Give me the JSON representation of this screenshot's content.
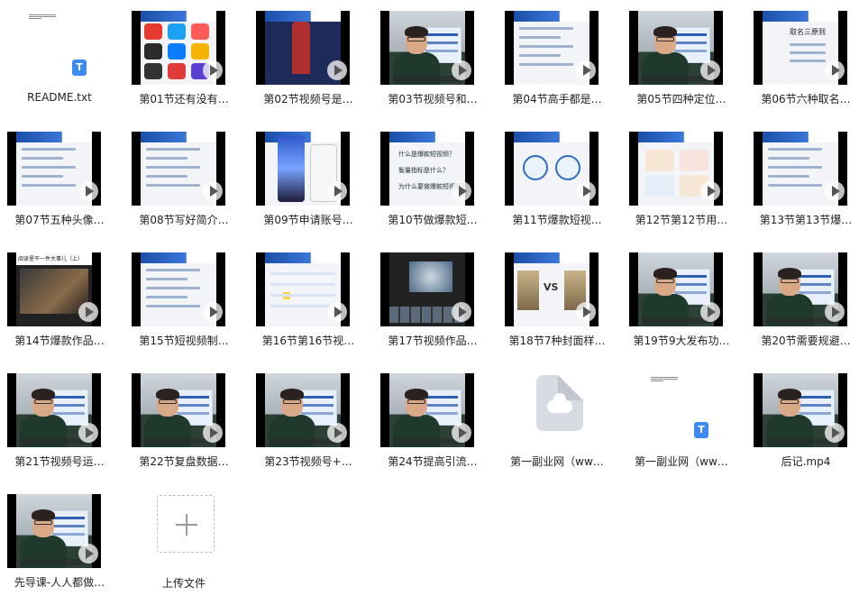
{
  "files": [
    {
      "name": "README.txt",
      "kind": "txt"
    },
    {
      "name": "第01节还有没有…",
      "kind": "video",
      "style": "apps"
    },
    {
      "name": "第02节视频号是…",
      "kind": "video",
      "style": "stage"
    },
    {
      "name": "第03节视频号和…",
      "kind": "video",
      "style": "person"
    },
    {
      "name": "第04节高手都是…",
      "kind": "video",
      "style": "list"
    },
    {
      "name": "第05节四种定位…",
      "kind": "video",
      "style": "person"
    },
    {
      "name": "第06节六种取名…",
      "kind": "video",
      "style": "slide",
      "slide_text": "取名三原则"
    },
    {
      "name": "第07节五种头像…",
      "kind": "video",
      "style": "slide"
    },
    {
      "name": "第08节写好简介…",
      "kind": "video",
      "style": "list"
    },
    {
      "name": "第09节申请账号…",
      "kind": "video",
      "style": "phone"
    },
    {
      "name": "第10节做爆款短…",
      "kind": "video",
      "style": "questions",
      "slide_lines": [
        "什么是爆款短视频？",
        "衡量指标是什么？",
        "为什么要做爆款短视频？"
      ]
    },
    {
      "name": "第11节爆款短视…",
      "kind": "video",
      "style": "circles"
    },
    {
      "name": "第12节第12节用…",
      "kind": "video",
      "style": "cards"
    },
    {
      "name": "第13节第13节爆…",
      "kind": "video",
      "style": "list"
    },
    {
      "name": "第14节爆款作品…",
      "kind": "video",
      "style": "dark",
      "slide_text": "阅读里干一件大事儿（上）"
    },
    {
      "name": "第15节短视频制…",
      "kind": "video",
      "style": "slide"
    },
    {
      "name": "第16节第16节视…",
      "kind": "video",
      "style": "timeline"
    },
    {
      "name": "第17节视频作品…",
      "kind": "video",
      "style": "editor"
    },
    {
      "name": "第18节7种封面样…",
      "kind": "video",
      "style": "vs",
      "slide_text": "VS"
    },
    {
      "name": "第19节9大发布功…",
      "kind": "video",
      "style": "person"
    },
    {
      "name": "第20节需要规避…",
      "kind": "video",
      "style": "person"
    },
    {
      "name": "第21节视频号运…",
      "kind": "video",
      "style": "person"
    },
    {
      "name": "第22节复盘数据…",
      "kind": "video",
      "style": "person"
    },
    {
      "name": "第23节视频号+…",
      "kind": "video",
      "style": "person"
    },
    {
      "name": "第24节提高引流…",
      "kind": "video",
      "style": "person"
    },
    {
      "name": "第一副业网（ww…",
      "kind": "cloud"
    },
    {
      "name": "第一副业网（ww…",
      "kind": "txt"
    },
    {
      "name": "后记.mp4",
      "kind": "video",
      "style": "person"
    },
    {
      "name": "先导课-人人都做…",
      "kind": "video",
      "style": "person"
    }
  ],
  "upload": {
    "label": "上传文件"
  }
}
